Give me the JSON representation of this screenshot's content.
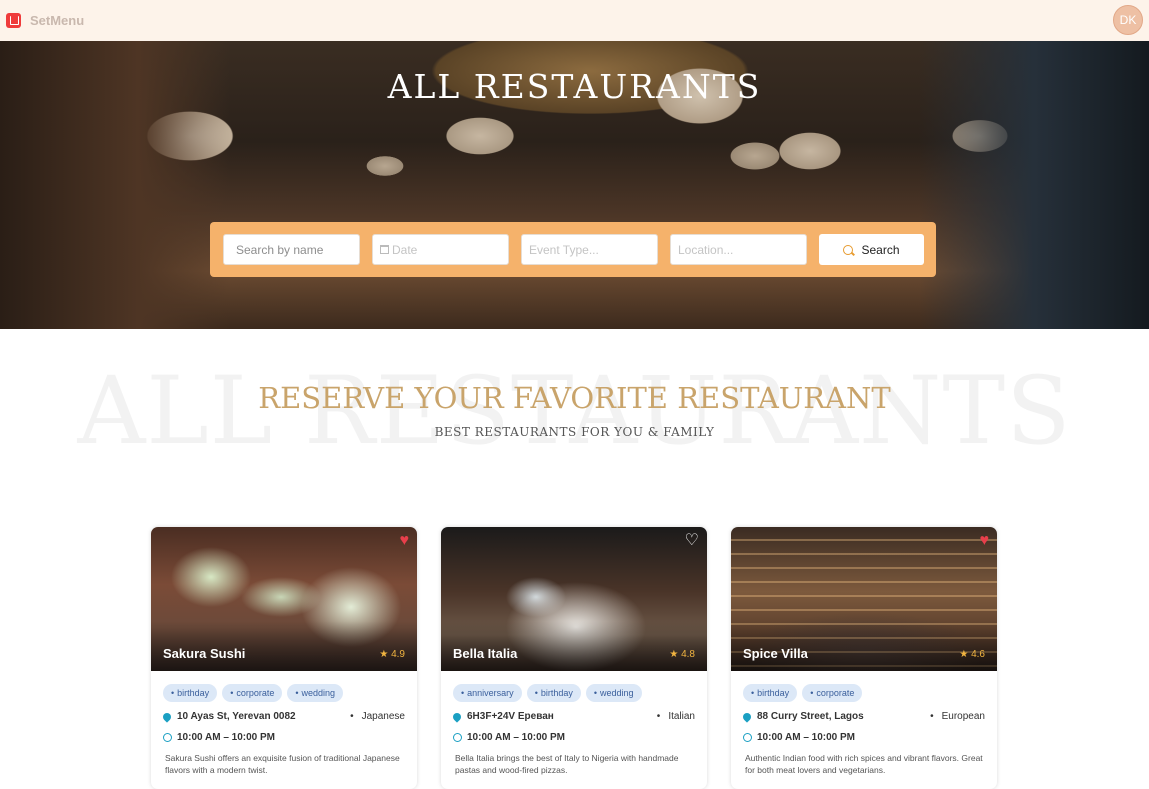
{
  "app": {
    "brand": "SetMenu",
    "user_initials": "DK"
  },
  "hero": {
    "title": "ALL RESTAURANTS",
    "search": {
      "name_placeholder": "Search by name",
      "date_placeholder": "Date",
      "event_placeholder": "Event Type...",
      "location_placeholder": "Location...",
      "button_label": "Search"
    }
  },
  "section": {
    "background_word": "ALL RESTAURANTS",
    "title": "RESERVE YOUR FAVORITE RESTAURANT",
    "subtitle": "BEST RESTAURANTS FOR YOU & FAMILY"
  },
  "restaurants": [
    {
      "name": "Sakura Sushi",
      "rating": "4.9",
      "favorite": true,
      "tags": [
        "birthday",
        "corporate",
        "wedding"
      ],
      "address": "10 Ayas St, Yerevan 0082",
      "cuisine": "Japanese",
      "hours": "10:00 AM – 10:00 PM",
      "description": "Sakura Sushi offers an exquisite fusion of traditional Japanese flavors with a modern twist."
    },
    {
      "name": "Bella Italia",
      "rating": "4.8",
      "favorite": false,
      "tags": [
        "anniversary",
        "birthday",
        "wedding"
      ],
      "address": "6H3F+24V Ереван",
      "cuisine": "Italian",
      "hours": "10:00 AM – 10:00 PM",
      "description": "Bella Italia brings the best of Italy to Nigeria with handmade pastas and wood-fired pizzas."
    },
    {
      "name": "Spice Villa",
      "rating": "4.6",
      "favorite": true,
      "tags": [
        "birthday",
        "corporate"
      ],
      "address": "88 Curry Street, Lagos",
      "cuisine": "European",
      "hours": "10:00 AM – 10:00 PM",
      "description": "Authentic Indian food with rich spices and vibrant flavors. Great for both meat lovers and vegetarians."
    }
  ],
  "icons": {
    "favorite_on_color": "#e83f4b",
    "accent": "#f5b26b",
    "title_gold": "#c9a46b"
  }
}
